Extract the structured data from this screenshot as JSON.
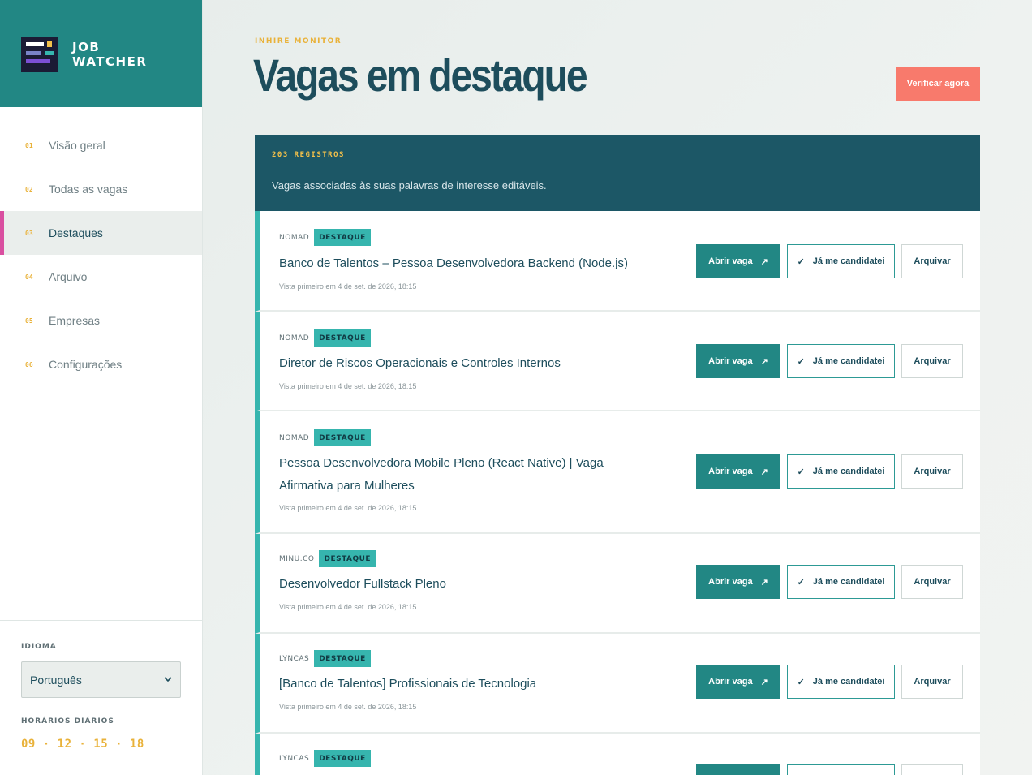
{
  "brand": {
    "line1": "JOB",
    "line2": "WATCHER"
  },
  "nav": [
    {
      "num": "01",
      "label": "Visão geral"
    },
    {
      "num": "02",
      "label": "Todas as vagas"
    },
    {
      "num": "03",
      "label": "Destaques",
      "active": true
    },
    {
      "num": "04",
      "label": "Arquivo"
    },
    {
      "num": "05",
      "label": "Empresas"
    },
    {
      "num": "06",
      "label": "Configurações"
    }
  ],
  "footer": {
    "language_label": "IDIOMA",
    "language_value": "Português",
    "schedule_label": "HORÁRIOS DIÁRIOS",
    "schedule": "09 · 12 · 15 · 18"
  },
  "header": {
    "eyebrow": "INHIRE MONITOR",
    "title": "Vagas em destaque",
    "check_button": "Verificar agora"
  },
  "summary": {
    "count": "203 REGISTROS",
    "description": "Vagas associadas às suas palavras de interesse editáveis."
  },
  "actions": {
    "open": "Abrir vaga",
    "open_icon": "↗",
    "applied": "Já me candidatei",
    "applied_icon": "✓",
    "archive": "Arquivar"
  },
  "jobs": [
    {
      "company": "NOMAD",
      "badge": "DESTAQUE",
      "title": "Banco de Talentos – Pessoa Desenvolvedora Backend (Node.js)",
      "seen": "Vista primeiro em 4 de set. de 2026, 18:15"
    },
    {
      "company": "NOMAD",
      "badge": "DESTAQUE",
      "title": "Diretor de Riscos Operacionais e Controles Internos",
      "seen": "Vista primeiro em 4 de set. de 2026, 18:15"
    },
    {
      "company": "NOMAD",
      "badge": "DESTAQUE",
      "title": "Pessoa Desenvolvedora Mobile Pleno (React Native) | Vaga Afirmativa para Mulheres",
      "seen": "Vista primeiro em 4 de set. de 2026, 18:15"
    },
    {
      "company": "MINU.CO",
      "badge": "DESTAQUE",
      "title": "Desenvolvedor Fullstack Pleno",
      "seen": "Vista primeiro em 4 de set. de 2026, 18:15"
    },
    {
      "company": "LYNCAS",
      "badge": "DESTAQUE",
      "title": "[Banco de Talentos] Profissionais de Tecnologia",
      "seen": "Vista primeiro em 4 de set. de 2026, 18:15"
    },
    {
      "company": "LYNCAS",
      "badge": "DESTAQUE",
      "title": "",
      "seen": ""
    }
  ]
}
